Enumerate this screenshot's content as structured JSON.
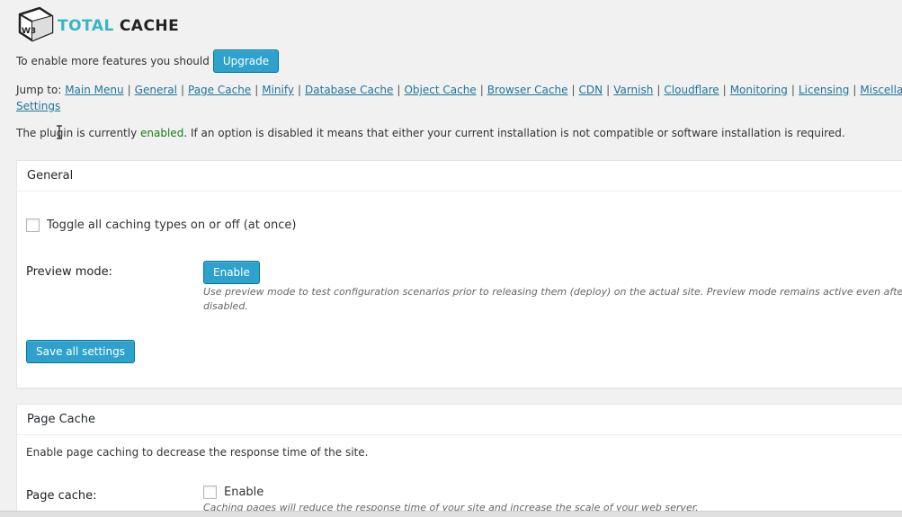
{
  "logo": {
    "total": "TOTAL",
    "cache": "CACHE",
    "badge": "W3",
    "icon": "w3-cube-logo-icon"
  },
  "upgrade": {
    "text": "To enable more features you should",
    "button_label": "Upgrade"
  },
  "jump": {
    "prefix": "Jump to:",
    "links": [
      "Main Menu",
      "General",
      "Page Cache",
      "Minify",
      "Database Cache",
      "Object Cache",
      "Browser Cache",
      "CDN",
      "Varnish",
      "Cloudflare",
      "Monitoring",
      "Licensing",
      "Miscellaneous"
    ],
    "links_line2": [
      "Settings"
    ]
  },
  "status": {
    "before": "The plugin is currently",
    "state": "enabled",
    "after": ". If an option is disabled it means that either your current installation is not compatible or software installation is required."
  },
  "general": {
    "title": "General",
    "toggle_label": "Toggle all caching types on or off (at once)",
    "preview_label": "Preview mode:",
    "preview_button": "Enable",
    "preview_desc_line1": "Use preview mode to test configuration scenarios prior to releasing them (deploy) on the actual site. Preview mode remains active even after deploying",
    "preview_desc_line2": "disabled.",
    "save_button": "Save all settings"
  },
  "page_cache": {
    "title": "Page Cache",
    "intro": "Enable page caching to decrease the response time of the site.",
    "label": "Page cache:",
    "enable_label": "Enable",
    "desc": "Caching pages will reduce the response time of your site and increase the scale of your web server."
  },
  "colors": {
    "accent": "#2ea2cc",
    "link": "#21759b",
    "enabled": "#1a7a1a",
    "logo_teal": "#38b6c5"
  }
}
